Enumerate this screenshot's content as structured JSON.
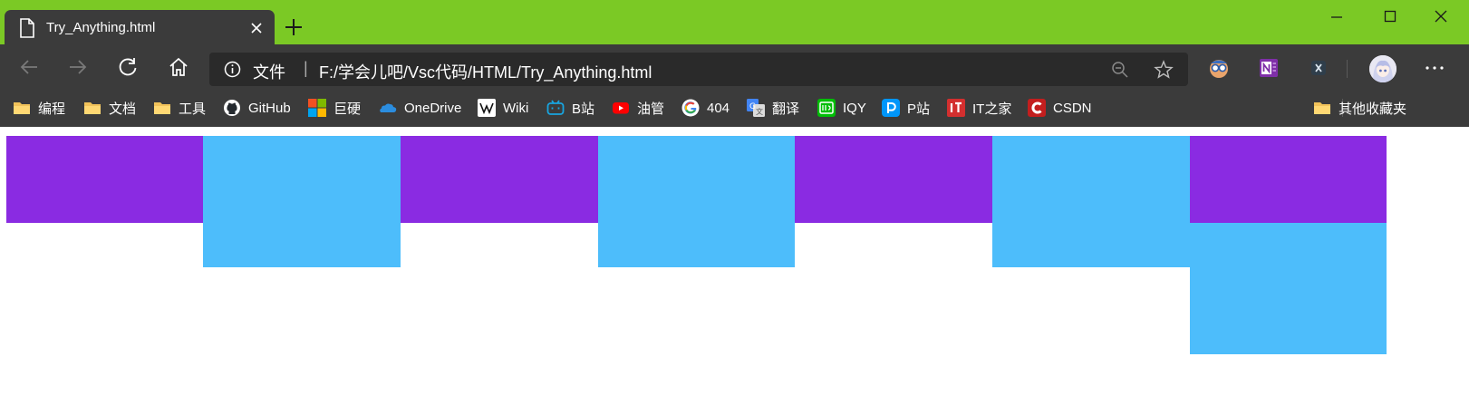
{
  "window": {
    "tab_title": "Try_Anything.html",
    "icons": {
      "page": "page-icon",
      "close": "close-icon",
      "new_tab": "plus-icon",
      "minimize": "minimize-icon",
      "maximize": "maximize-icon",
      "window_close": "close-icon"
    },
    "frame_color": "#7bc925"
  },
  "toolbar": {
    "scheme_label": "文件",
    "separator": "|",
    "url": "F:/学会儿吧/Vsc代码/HTML/Try_Anything.html",
    "icons": [
      "back-icon",
      "forward-icon",
      "refresh-icon",
      "home-icon",
      "info-icon",
      "zoom-icon",
      "favorite-star-icon",
      "extension-glasses-icon",
      "onenote-icon",
      "extension-x-icon",
      "profile-avatar",
      "more-icon"
    ]
  },
  "bookmarks": {
    "items": [
      {
        "label": "编程",
        "icon": "folder-icon"
      },
      {
        "label": "文档",
        "icon": "folder-icon"
      },
      {
        "label": "工具",
        "icon": "folder-icon"
      },
      {
        "label": "GitHub",
        "icon": "github-icon"
      },
      {
        "label": "巨硬",
        "icon": "microsoft-icon"
      },
      {
        "label": "OneDrive",
        "icon": "onedrive-icon"
      },
      {
        "label": "Wiki",
        "icon": "wikipedia-icon"
      },
      {
        "label": "B站",
        "icon": "bilibili-icon"
      },
      {
        "label": "油管",
        "icon": "youtube-icon"
      },
      {
        "label": "404",
        "icon": "google-icon"
      },
      {
        "label": "翻译",
        "icon": "translate-icon"
      },
      {
        "label": "IQY",
        "icon": "iqiyi-icon"
      },
      {
        "label": "P站",
        "icon": "pixiv-icon"
      },
      {
        "label": "IT之家",
        "icon": "ithome-icon"
      },
      {
        "label": "CSDN",
        "icon": "csdn-icon"
      }
    ],
    "other": {
      "label": "其他收藏夹",
      "icon": "folder-icon"
    }
  },
  "content": {
    "colors": {
      "purple": "#8a2be2",
      "blue": "#4dbdfb"
    },
    "boxes": [
      "purple",
      "blue",
      "purple",
      "blue",
      "purple",
      "blue",
      "purple",
      "blue"
    ]
  }
}
